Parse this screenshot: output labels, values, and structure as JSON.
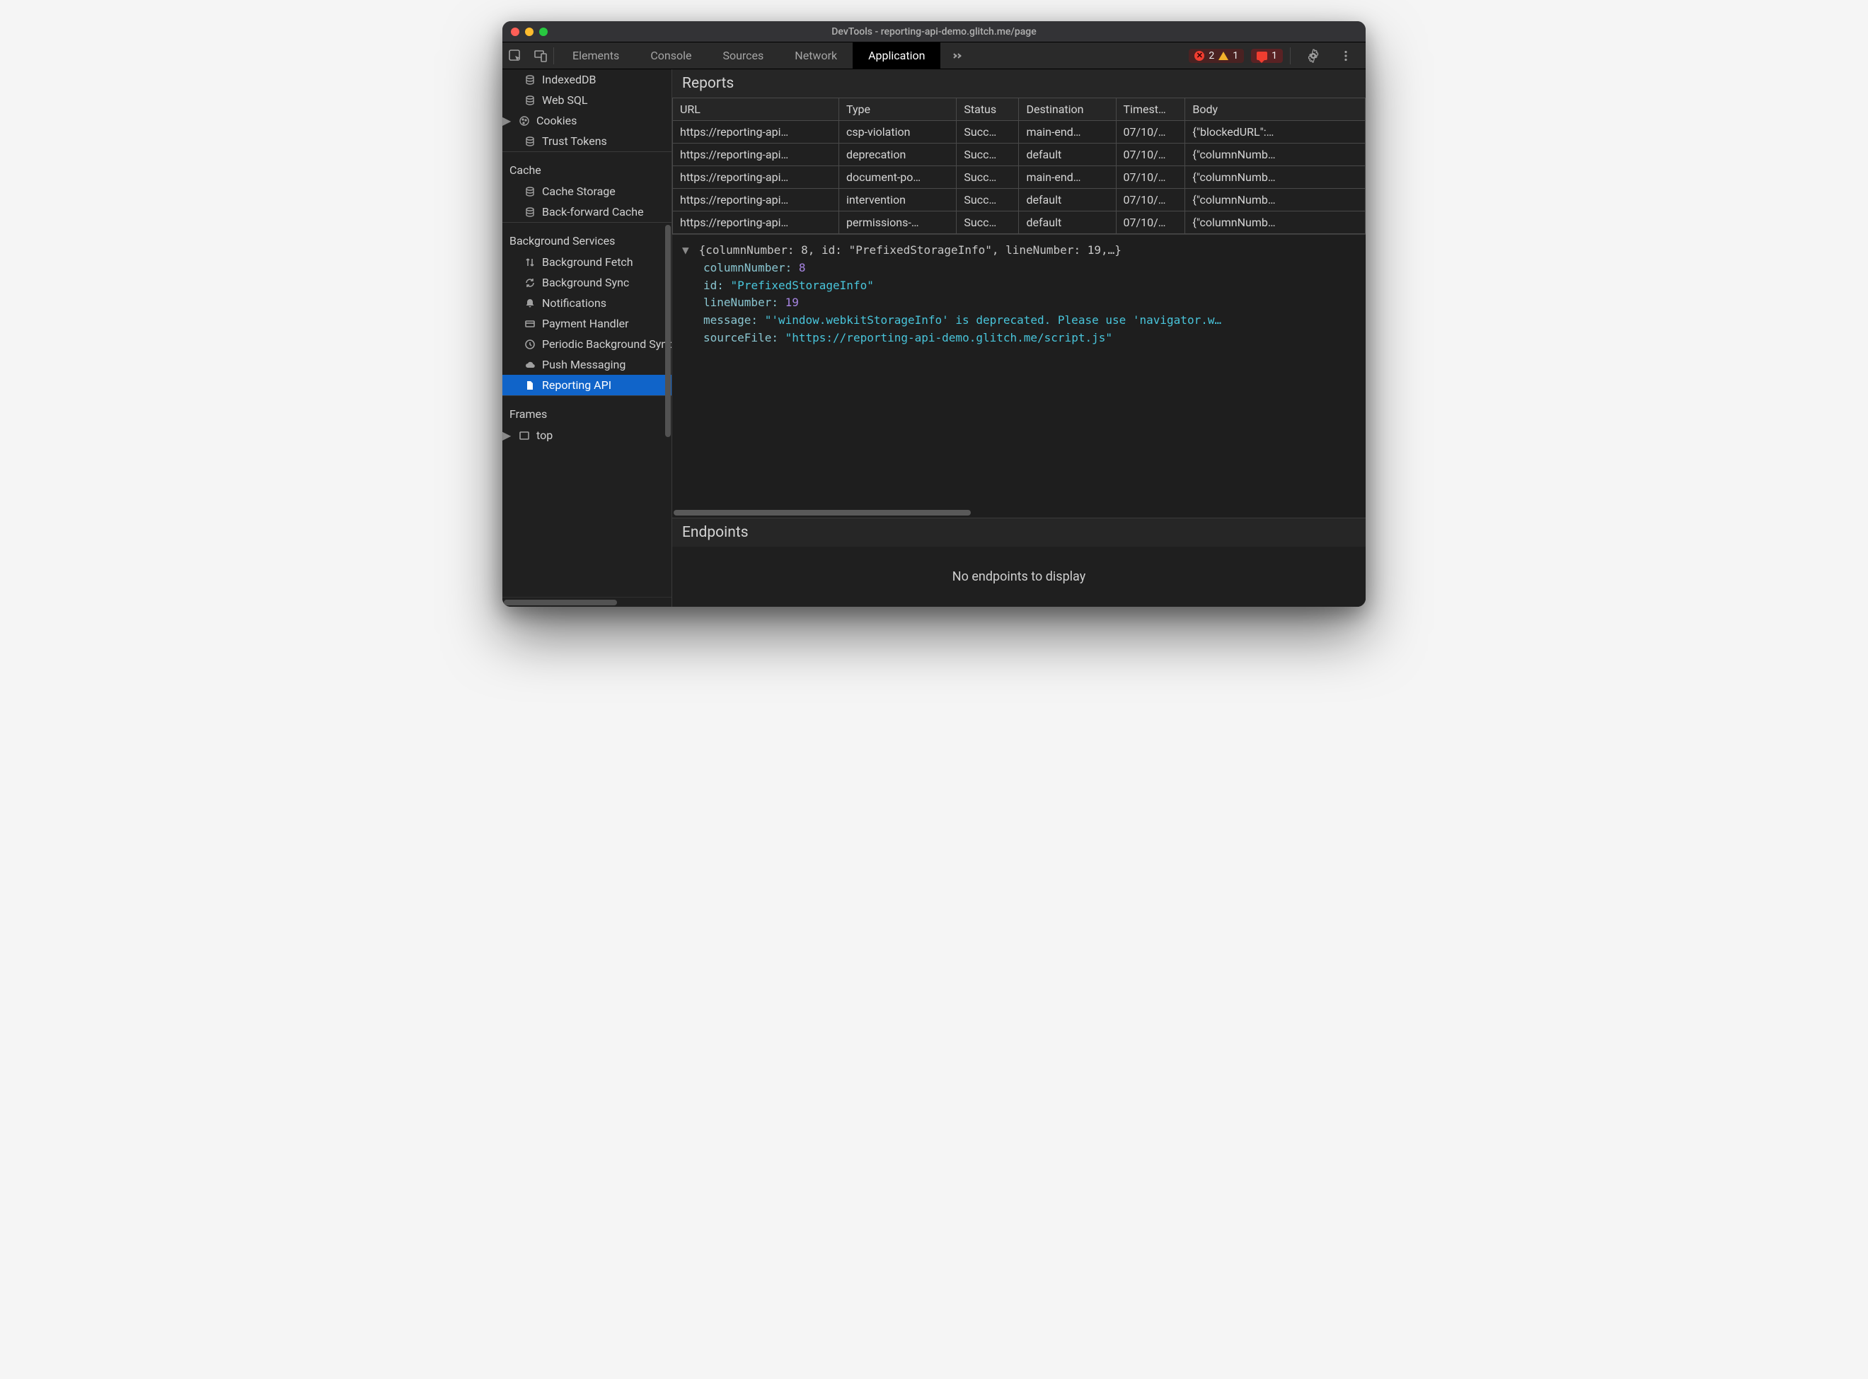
{
  "window": {
    "title": "DevTools - reporting-api-demo.glitch.me/page"
  },
  "tabs": {
    "items": [
      "Elements",
      "Console",
      "Sources",
      "Network",
      "Application"
    ],
    "activeIndex": 4
  },
  "toolbarCounts": {
    "errors": "2",
    "warnings": "1",
    "messages": "1"
  },
  "sidebar": {
    "storage": [
      {
        "icon": "db-icon",
        "label": "IndexedDB"
      },
      {
        "icon": "db-icon",
        "label": "Web SQL"
      },
      {
        "icon": "cookie-icon",
        "label": "Cookies",
        "expandable": true
      },
      {
        "icon": "db-icon",
        "label": "Trust Tokens"
      }
    ],
    "cache_heading": "Cache",
    "cache": [
      {
        "icon": "db-icon",
        "label": "Cache Storage"
      },
      {
        "icon": "db-icon",
        "label": "Back-forward Cache"
      }
    ],
    "bg_heading": "Background Services",
    "bg": [
      {
        "icon": "swap-icon",
        "label": "Background Fetch"
      },
      {
        "icon": "sync-icon",
        "label": "Background Sync"
      },
      {
        "icon": "bell-icon",
        "label": "Notifications"
      },
      {
        "icon": "card-icon",
        "label": "Payment Handler"
      },
      {
        "icon": "clock-icon",
        "label": "Periodic Background Sync"
      },
      {
        "icon": "cloud-icon",
        "label": "Push Messaging"
      },
      {
        "icon": "file-icon",
        "label": "Reporting API",
        "selected": true
      }
    ],
    "frames_heading": "Frames",
    "frames": [
      {
        "icon": "frame-icon",
        "label": "top",
        "expandable": true
      }
    ]
  },
  "reports": {
    "heading": "Reports",
    "headers": [
      "URL",
      "Type",
      "Status",
      "Destination",
      "Timest…",
      "Body"
    ],
    "rows": [
      {
        "url": "https://reporting-api…",
        "type": "csp-violation",
        "status": "Succ…",
        "dest": "main-end…",
        "ts": "07/10/…",
        "body": "{\"blockedURL\":…"
      },
      {
        "url": "https://reporting-api…",
        "type": "deprecation",
        "status": "Succ…",
        "dest": "default",
        "ts": "07/10/…",
        "body": "{\"columnNumb…"
      },
      {
        "url": "https://reporting-api…",
        "type": "document-po…",
        "status": "Succ…",
        "dest": "main-end…",
        "ts": "07/10/…",
        "body": "{\"columnNumb…"
      },
      {
        "url": "https://reporting-api…",
        "type": "intervention",
        "status": "Succ…",
        "dest": "default",
        "ts": "07/10/…",
        "body": "{\"columnNumb…"
      },
      {
        "url": "https://reporting-api…",
        "type": "permissions-…",
        "status": "Succ…",
        "dest": "default",
        "ts": "07/10/…",
        "body": "{\"columnNumb…"
      }
    ]
  },
  "detail": {
    "summary": "{columnNumber: 8, id: \"PrefixedStorageInfo\", lineNumber: 19,…}",
    "columnNumber_label": "columnNumber:",
    "columnNumber": "8",
    "id_label": "id:",
    "id": "\"PrefixedStorageInfo\"",
    "lineNumber_label": "lineNumber:",
    "lineNumber": "19",
    "message_label": "message:",
    "message": "\"'window.webkitStorageInfo' is deprecated. Please use 'navigator.w…",
    "sourceFile_label": "sourceFile:",
    "sourceFile": "\"https://reporting-api-demo.glitch.me/script.js\""
  },
  "endpoints": {
    "heading": "Endpoints",
    "empty": "No endpoints to display"
  }
}
